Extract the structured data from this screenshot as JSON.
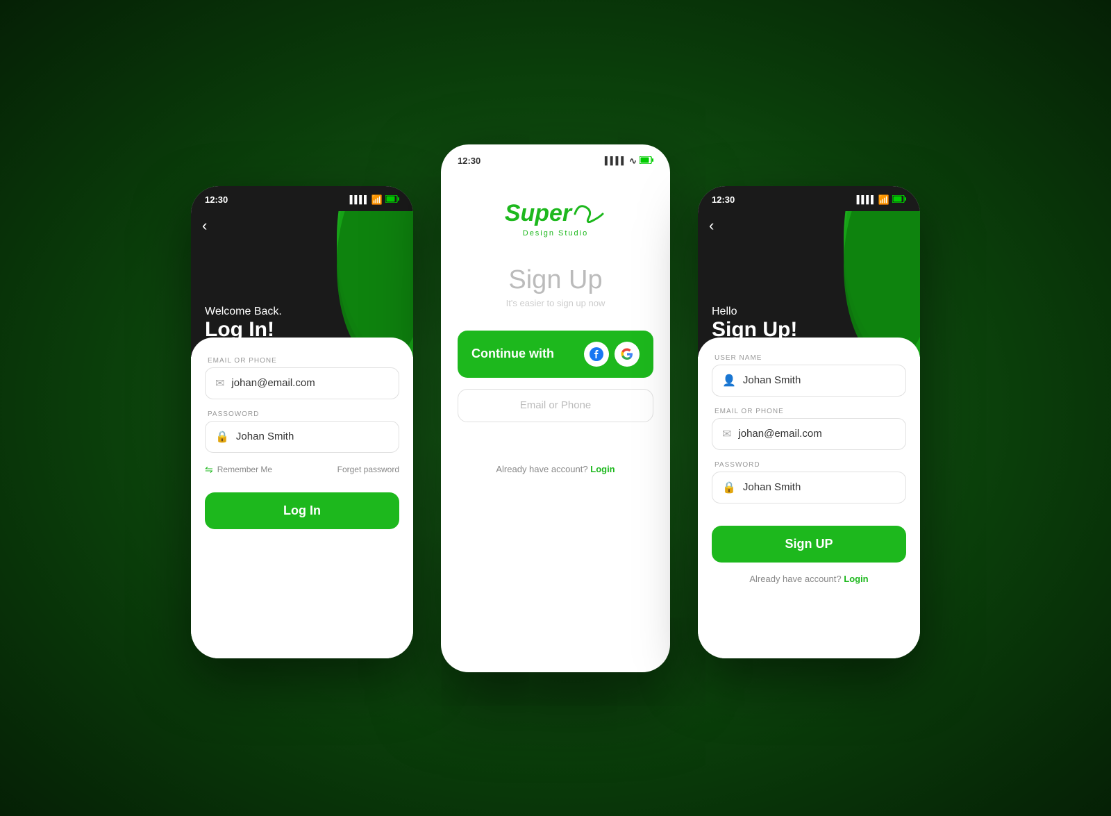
{
  "background": "#0a3d0a",
  "colors": {
    "green": "#1db81d",
    "dark": "#1a1a1a",
    "white": "#ffffff",
    "gray": "#999999",
    "light_border": "#e0e0e0"
  },
  "status_bar": {
    "time": "12:30",
    "signal": "▌▌▌▌",
    "wifi": "wifi",
    "battery": "battery"
  },
  "left_phone": {
    "back_label": "‹",
    "subtitle": "Welcome Back.",
    "title": "Log In!",
    "email_label": "EMAIL OR PHONE",
    "email_value": "johan@email.com",
    "password_label": "PASSOWORD",
    "password_value": "Johan Smith",
    "remember_label": "Remember Me",
    "forget_label": "Forget password",
    "login_btn": "Log In"
  },
  "center_phone": {
    "logo_text": "Super",
    "logo_swoosh": "∞",
    "logo_subtitle": "Design Studio",
    "sign_up_title": "Sign Up",
    "sign_up_sub": "It's easier to sign up now",
    "continue_btn": "Continue with",
    "email_phone_placeholder": "Email or Phone",
    "already_text": "Already have account?",
    "login_link": "Login"
  },
  "right_phone": {
    "back_label": "‹",
    "subtitle": "Hello",
    "title": "Sign Up!",
    "username_label": "USER NAME",
    "username_value": "Johan Smith",
    "email_label": "EMAIL OR PHONE",
    "email_value": "johan@email.com",
    "password_label": "PASSWORD",
    "password_value": "Johan Smith",
    "signup_btn": "Sign UP",
    "already_text": "Already have account?",
    "login_link": "Login"
  }
}
